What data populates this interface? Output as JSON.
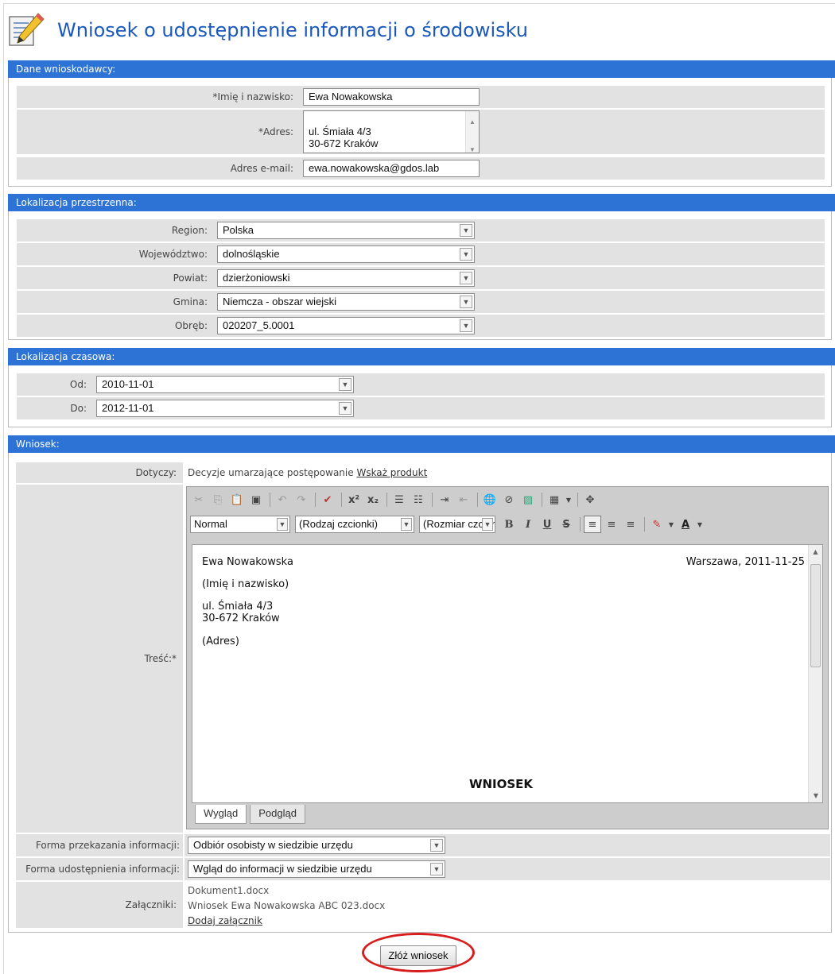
{
  "title": "Wniosek o udostępnienie informacji o środowisku",
  "sections": {
    "applicant": "Dane wnioskodawcy:",
    "spatial": "Lokalizacja przestrzenna:",
    "temporal": "Lokalizacja czasowa:",
    "request": "Wniosek:"
  },
  "applicant": {
    "name_label": "*Imię i nazwisko:",
    "name_value": "Ewa Nowakowska",
    "address_label": "*Adres:",
    "address_value": "ul. Śmiała 4/3\n30-672 Kraków",
    "email_label": "Adres e-mail:",
    "email_value": "ewa.nowakowska@gdos.lab"
  },
  "spatial": {
    "region_label": "Region:",
    "region_value": "Polska",
    "voivodeship_label": "Województwo:",
    "voivodeship_value": "dolnośląskie",
    "county_label": "Powiat:",
    "county_value": "dzierżoniowski",
    "commune_label": "Gmina:",
    "commune_value": "Niemcza - obszar wiejski",
    "precinct_label": "Obręb:",
    "precinct_value": "020207_5.0001"
  },
  "temporal": {
    "from_label": "Od:",
    "from_value": "2010-11-01",
    "to_label": "Do:",
    "to_value": "2012-11-01"
  },
  "request": {
    "concerns_label": "Dotyczy:",
    "concerns_value": "Decyzje umarzające postępowanie",
    "concerns_link": "Wskaż produkt",
    "content_label": "Treść:*",
    "editor": {
      "format": "Normal",
      "font": "(Rodzaj czcionki)",
      "size": "(Rozmiar czcionki)",
      "body": {
        "name": "Ewa Nowakowska",
        "place_date": "Warszawa, 2011-11-25",
        "name_caption": "(Imię i nazwisko)",
        "address": "ul. Śmiała 4/3\n30-672 Kraków",
        "address_caption": "(Adres)",
        "heading": "WNIOSEK"
      },
      "tab_design": "Wygląd",
      "tab_preview": "Podgląd"
    },
    "delivery_label": "Forma przekazania informacji:",
    "delivery_value": "Odbiór osobisty w siedzibie urzędu",
    "access_label": "Forma udostępnienia informacji:",
    "access_value": "Wgląd do informacji w siedzibie urzędu",
    "attachments_label": "Załączniki:",
    "attachments": [
      "Dokument1.docx",
      "Wniosek Ewa Nowakowska ABC 023.docx"
    ],
    "add_attachment": "Dodaj załącznik"
  },
  "submit_label": "Złóż wniosek"
}
